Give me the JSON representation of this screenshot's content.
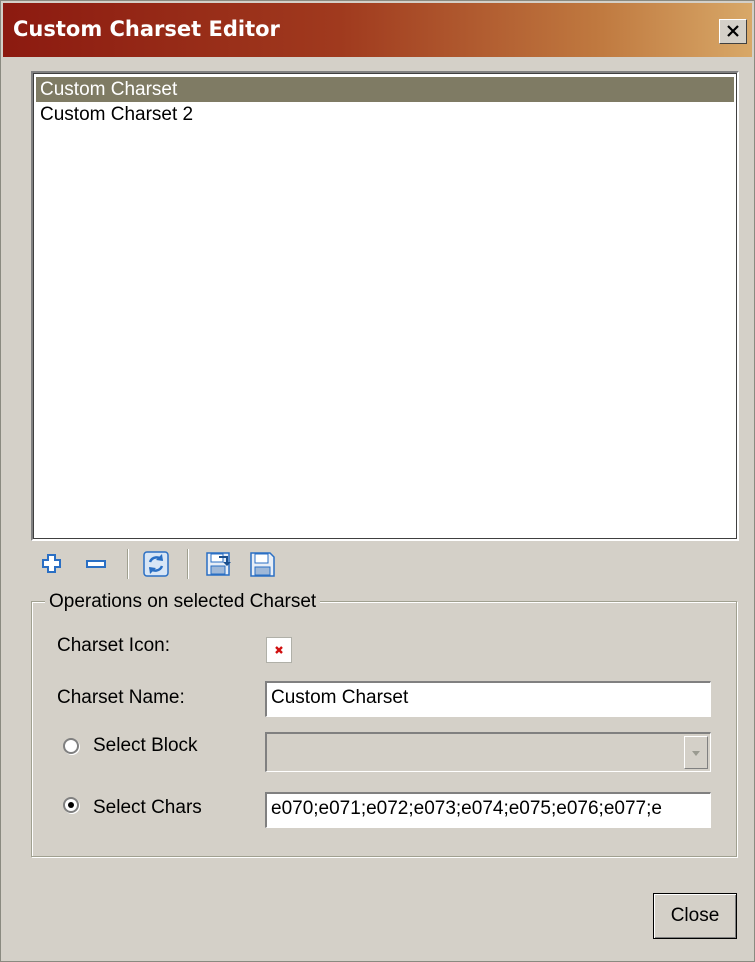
{
  "window": {
    "title": "Custom Charset Editor",
    "close_glyph": "✕"
  },
  "charset_list": {
    "items": [
      {
        "label": "Custom Charset",
        "selected": true
      },
      {
        "label": "Custom Charset 2",
        "selected": false
      }
    ]
  },
  "toolbar": {
    "icons": [
      "add-icon",
      "remove-icon",
      "refresh-icon",
      "import-icon",
      "save-icon"
    ],
    "colors": {
      "accent": "#2a6fc4"
    }
  },
  "operations": {
    "group_title": "Operations on selected Charset",
    "icon_label": "Charset Icon:",
    "name_label": "Charset Name:",
    "name_value": "Custom Charset",
    "select_block_label": "Select Block",
    "select_block_value": "",
    "select_chars_label": "Select Chars",
    "select_chars_value": "e070;e071;e072;e073;e074;e075;e076;e077;e",
    "selected_mode": "Select Chars"
  },
  "footer": {
    "close_label": "Close"
  },
  "colors": {
    "title_gradient_start": "#8c1a10",
    "title_gradient_end": "#d8a868",
    "dialog_bg": "#d4d0c8",
    "selection_bg": "#7f7b64"
  }
}
